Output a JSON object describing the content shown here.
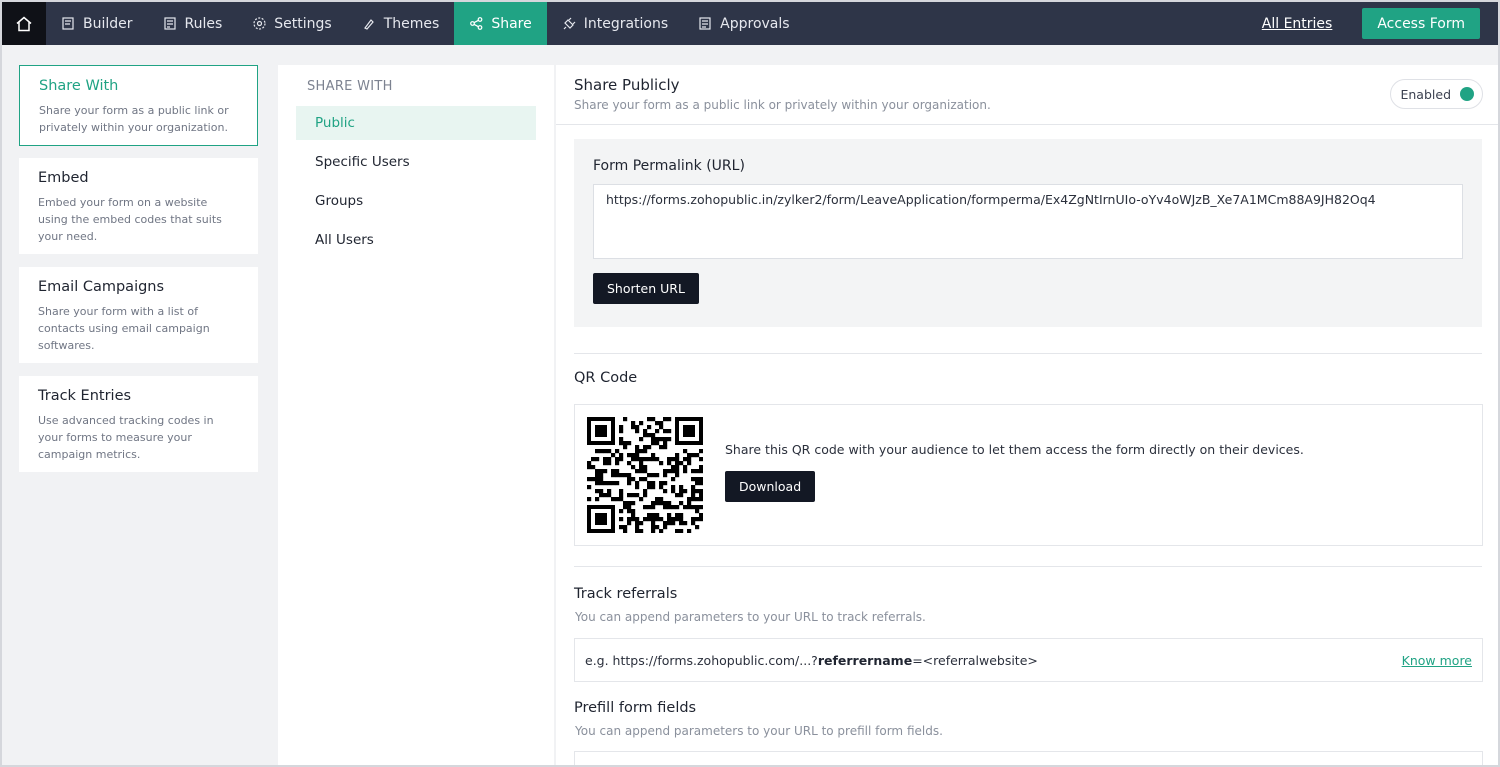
{
  "nav": {
    "items": [
      {
        "label": "Builder",
        "icon": "builder-icon"
      },
      {
        "label": "Rules",
        "icon": "rules-icon"
      },
      {
        "label": "Settings",
        "icon": "gear-icon"
      },
      {
        "label": "Themes",
        "icon": "brush-icon"
      },
      {
        "label": "Share",
        "icon": "share-icon",
        "active": true
      },
      {
        "label": "Integrations",
        "icon": "plug-icon"
      },
      {
        "label": "Approvals",
        "icon": "approvals-icon"
      }
    ],
    "all_entries": "All Entries",
    "access_form": "Access Form"
  },
  "left": {
    "cards": [
      {
        "title": "Share With",
        "desc": "Share your form as a public link or privately within your organization.",
        "active": true
      },
      {
        "title": "Embed",
        "desc": "Embed your form on a website using the embed codes that suits your need."
      },
      {
        "title": "Email Campaigns",
        "desc": "Share your form with a list of contacts using email campaign softwares."
      },
      {
        "title": "Track Entries",
        "desc": "Use advanced tracking codes in your forms to measure your campaign metrics."
      }
    ]
  },
  "middle": {
    "heading": "SHARE WITH",
    "items": [
      "Public",
      "Specific Users",
      "Groups",
      "All Users"
    ]
  },
  "main": {
    "title": "Share Publicly",
    "subtitle": "Share your form as a public link or privately within your organization.",
    "toggle_label": "Enabled",
    "permalink_label": "Form Permalink (URL)",
    "permalink_value": "https://forms.zohopublic.in/zylker2/form/LeaveApplication/formperma/Ex4ZgNtIrnUIo-oYv4oWJzB_Xe7A1MCm88A9JH82Oq4",
    "shorten_url": "Shorten URL",
    "qr_title": "QR Code",
    "qr_text": "Share this QR code with your audience to let them access the form directly on their devices.",
    "download": "Download",
    "track_title": "Track referrals",
    "track_sub": "You can append parameters to your URL to track referrals.",
    "ref_prefix": "e.g. https://forms.zohopublic.com/...?",
    "ref_param": "referrername",
    "ref_suffix": "=<referralwebsite>",
    "know_more": "Know more",
    "prefill_title": "Prefill form fields",
    "prefill_sub": "You can append parameters to your URL to prefill form fields."
  }
}
